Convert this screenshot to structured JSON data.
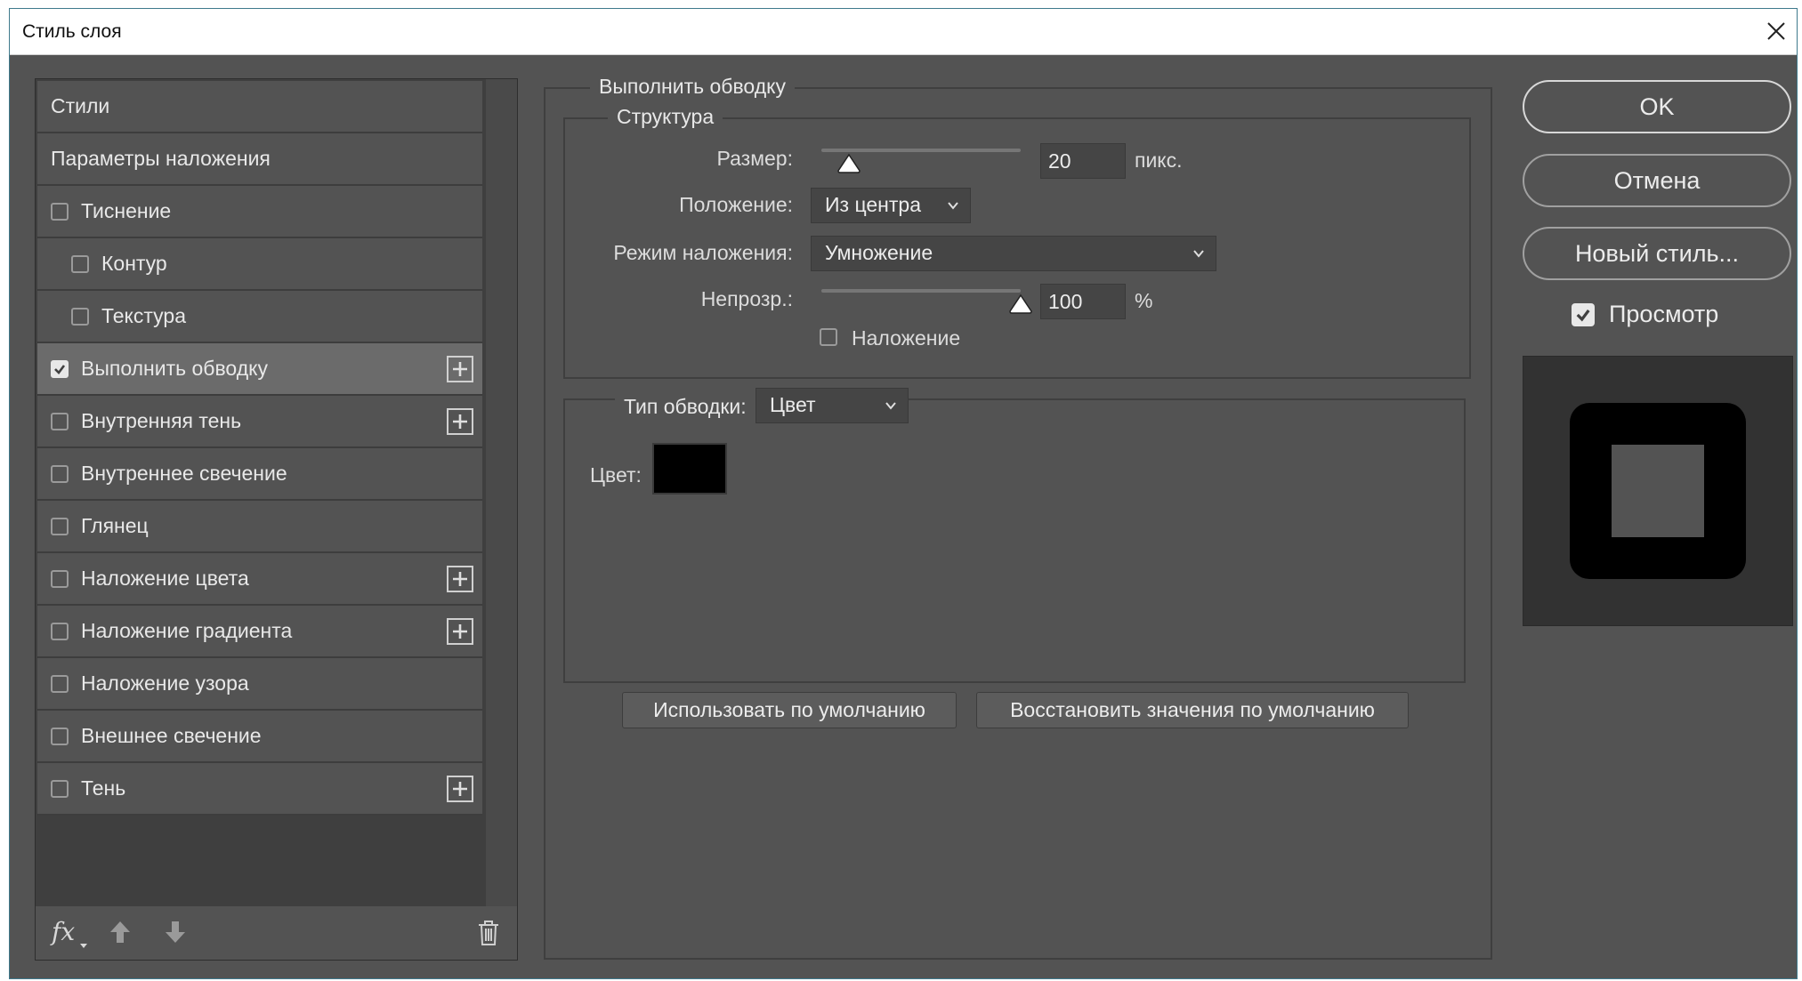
{
  "window": {
    "title": "Стиль слоя"
  },
  "styles": {
    "items": [
      {
        "label": "Стили",
        "kind": "header",
        "checked": false,
        "plus": false,
        "selected": false
      },
      {
        "label": "Параметры наложения",
        "kind": "header",
        "checked": false,
        "plus": false,
        "selected": false
      },
      {
        "label": "Тиснение",
        "kind": "check",
        "checked": false,
        "plus": false,
        "selected": false
      },
      {
        "label": "Контур",
        "kind": "sub",
        "checked": false,
        "plus": false,
        "selected": false
      },
      {
        "label": "Текстура",
        "kind": "sub",
        "checked": false,
        "plus": false,
        "selected": false
      },
      {
        "label": "Выполнить обводку",
        "kind": "check",
        "checked": true,
        "plus": true,
        "selected": true
      },
      {
        "label": "Внутренняя тень",
        "kind": "check",
        "checked": false,
        "plus": true,
        "selected": false
      },
      {
        "label": "Внутреннее свечение",
        "kind": "check",
        "checked": false,
        "plus": false,
        "selected": false
      },
      {
        "label": "Глянец",
        "kind": "check",
        "checked": false,
        "plus": false,
        "selected": false
      },
      {
        "label": "Наложение цвета",
        "kind": "check",
        "checked": false,
        "plus": true,
        "selected": false
      },
      {
        "label": "Наложение градиента",
        "kind": "check",
        "checked": false,
        "plus": true,
        "selected": false
      },
      {
        "label": "Наложение узора",
        "kind": "check",
        "checked": false,
        "plus": false,
        "selected": false
      },
      {
        "label": "Внешнее свечение",
        "kind": "check",
        "checked": false,
        "plus": false,
        "selected": false
      },
      {
        "label": "Тень",
        "kind": "check",
        "checked": false,
        "plus": true,
        "selected": false
      }
    ],
    "footer": {
      "fx_label": "fx"
    }
  },
  "stroke": {
    "group_title": "Выполнить обводку",
    "structure_title": "Структура",
    "size": {
      "label": "Размер:",
      "value": "20",
      "unit": "пикс.",
      "slider_fraction": 0.14
    },
    "position": {
      "label": "Положение:",
      "value": "Из центра"
    },
    "blend_mode": {
      "label": "Режим наложения:",
      "value": "Умножение"
    },
    "opacity": {
      "label": "Непрозр.:",
      "value": "100",
      "unit": "%",
      "slider_fraction": 1.0
    },
    "overprint": {
      "label": "Наложение",
      "checked": false
    },
    "fill_type": {
      "label": "Тип обводки:",
      "value": "Цвет"
    },
    "color": {
      "label": "Цвет:",
      "value": "#000000"
    },
    "buttons": {
      "make_default": "Использовать по умолчанию",
      "reset_default": "Восстановить значения по умолчанию"
    }
  },
  "actions": {
    "ok": "OK",
    "cancel": "Отмена",
    "new_style": "Новый стиль...",
    "preview_label": "Просмотр",
    "preview_checked": true
  },
  "colors": {
    "dialog_bg": "#535353",
    "panel_bg": "#3f3f3f",
    "selected_item": "#6b6b6b",
    "preview_bg": "#323232",
    "preview_stroke": "#000000",
    "preview_fill": "#535353"
  }
}
